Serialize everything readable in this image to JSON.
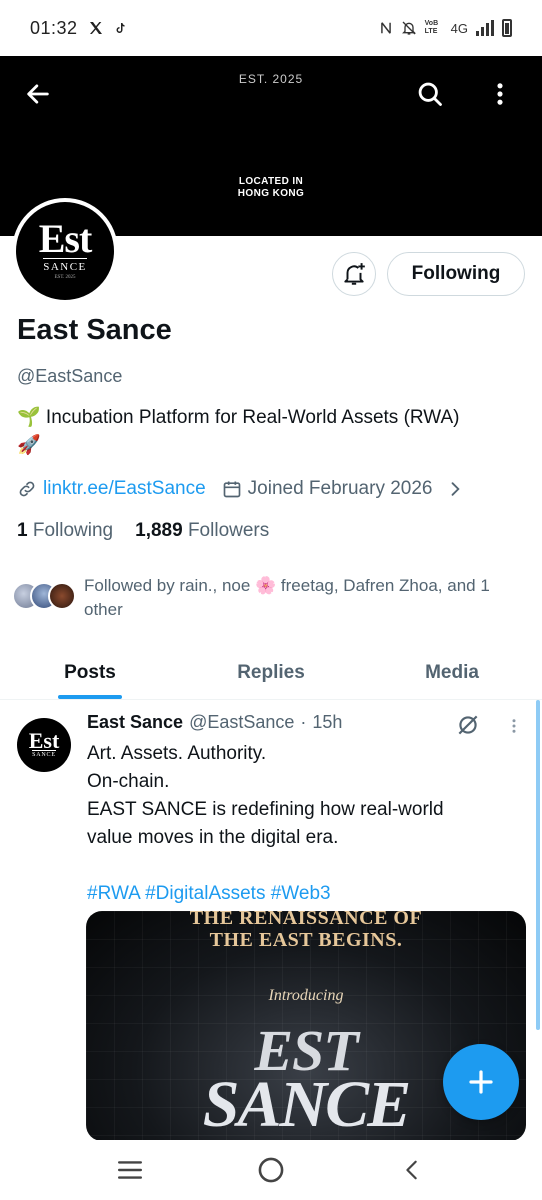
{
  "status_bar": {
    "time": "01:32",
    "network": "4G",
    "volte": "VoB LTE"
  },
  "banner": {
    "established": "EST. 2025",
    "location_line1": "LOCATED IN",
    "location_line2": "HONG KONG"
  },
  "avatar": {
    "logo_top": "Est",
    "logo_bottom": "SANCE",
    "logo_tiny": "EST. 2025"
  },
  "actions": {
    "follow_label": "Following"
  },
  "profile": {
    "name": "East Sance",
    "handle": "@EastSance",
    "bio_line1": "🌱 Incubation Platform for Real-World Assets (RWA)",
    "bio_line2": "🚀",
    "link": "linktr.ee/EastSance",
    "joined": "Joined February 2026",
    "following_count": "1",
    "following_label": "Following",
    "followers_count": "1,889",
    "followers_label": "Followers",
    "followed_by": "Followed by rain., noe 🌸 freetag, Dafren Zhoa, and 1 other"
  },
  "tabs": [
    "Posts",
    "Replies",
    "Media"
  ],
  "post": {
    "author": "East Sance",
    "handle": "@EastSance",
    "time": "15h",
    "lines": [
      "Art. Assets. Authority.",
      "On-chain.",
      "EAST SANCE is redefining how real-world",
      "value moves in the digital era.",
      ""
    ],
    "hashtags": "#RWA #DigitalAssets #Web3",
    "media": {
      "headline1": "THE RENAISSANCE OF",
      "headline2": "THE EAST BEGINS.",
      "introducing": "Introducing",
      "brand1": "EST",
      "brand2": "SANCE"
    }
  },
  "colors": {
    "accent": "#1d9bf0",
    "text_primary": "#0f1419",
    "text_secondary": "#536471",
    "banner_bg": "#000000"
  }
}
